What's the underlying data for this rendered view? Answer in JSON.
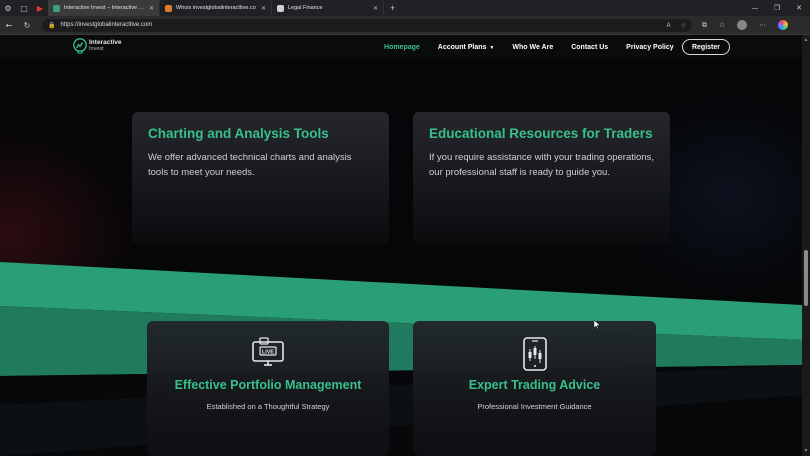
{
  "browser": {
    "tabs": [
      {
        "title": "Interactive Invest – Interactive Inv",
        "favicon_color": "#3aa27a",
        "active": true
      },
      {
        "title": "Whois investglobalinteracttive.co",
        "favicon_color": "#e07a2a",
        "active": false
      },
      {
        "title": "Legal Finance",
        "favicon_color": "#cfcfcf",
        "active": false
      }
    ],
    "url": "https://investglobalinteracttive.com"
  },
  "site": {
    "logo": {
      "line1": "Interactive",
      "line2": "Invest"
    },
    "nav": [
      {
        "label": "Homepage",
        "active": true
      },
      {
        "label": "Account Plans",
        "dropdown": true
      },
      {
        "label": "Who We Are"
      },
      {
        "label": "Contact Us"
      },
      {
        "label": "Privacy Policy"
      }
    ],
    "register_label": "Register"
  },
  "features": [
    {
      "title": "Charting and Analysis Tools",
      "text": "We offer advanced technical charts and analysis tools to meet your needs."
    },
    {
      "title": "Educational Resources for Traders",
      "text": "If you require assistance with your trading operations, our professional staff is ready to guide you."
    }
  ],
  "services": [
    {
      "title": "Effective Portfolio Management",
      "subtitle": "Established on a Thoughtful Strategy",
      "icon": "live-monitor-icon"
    },
    {
      "title": "Expert Trading Advice",
      "subtitle": "Professional Investment Guidance",
      "icon": "phone-candlestick-icon"
    }
  ],
  "colors": {
    "accent": "#39c08a",
    "wave": "#2a9e77",
    "background": "#050608"
  }
}
